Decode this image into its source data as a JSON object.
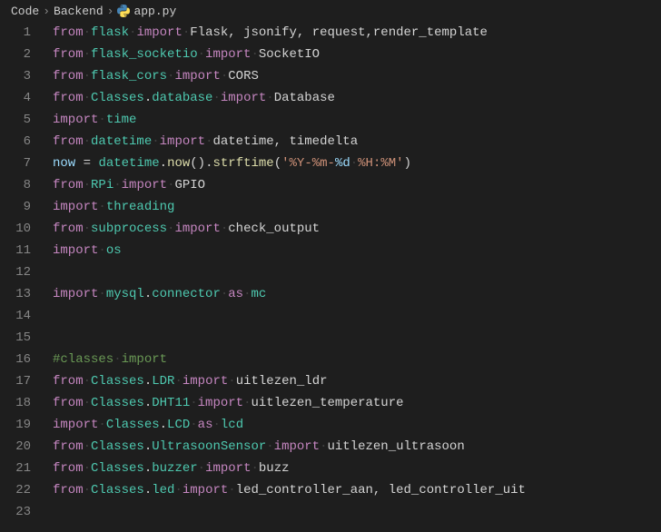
{
  "breadcrumb": {
    "items": [
      "Code",
      "Backend",
      "app.py"
    ],
    "file_icon": "python-icon"
  },
  "editor": {
    "line_count": 23,
    "lines": [
      [
        {
          "c": "tk-kw",
          "t": "from"
        },
        {
          "c": "tk-ws",
          "t": "·"
        },
        {
          "c": "tk-mod",
          "t": "flask"
        },
        {
          "c": "tk-ws",
          "t": "·"
        },
        {
          "c": "tk-kw",
          "t": "import"
        },
        {
          "c": "tk-ws",
          "t": "·"
        },
        {
          "c": "tk-id",
          "t": "Flask, jsonify, request,render_template"
        }
      ],
      [
        {
          "c": "tk-kw",
          "t": "from"
        },
        {
          "c": "tk-ws",
          "t": "·"
        },
        {
          "c": "tk-mod",
          "t": "flask_socketio"
        },
        {
          "c": "tk-ws",
          "t": "·"
        },
        {
          "c": "tk-kw",
          "t": "import"
        },
        {
          "c": "tk-ws",
          "t": "·"
        },
        {
          "c": "tk-id",
          "t": "SocketIO"
        }
      ],
      [
        {
          "c": "tk-kw",
          "t": "from"
        },
        {
          "c": "tk-ws",
          "t": "·"
        },
        {
          "c": "tk-mod",
          "t": "flask_cors"
        },
        {
          "c": "tk-ws",
          "t": "·"
        },
        {
          "c": "tk-kw",
          "t": "import"
        },
        {
          "c": "tk-ws",
          "t": "·"
        },
        {
          "c": "tk-id",
          "t": "CORS"
        }
      ],
      [
        {
          "c": "tk-kw",
          "t": "from"
        },
        {
          "c": "tk-ws",
          "t": "·"
        },
        {
          "c": "tk-mod",
          "t": "Classes"
        },
        {
          "c": "tk-punc",
          "t": "."
        },
        {
          "c": "tk-mod",
          "t": "database"
        },
        {
          "c": "tk-ws",
          "t": "·"
        },
        {
          "c": "tk-kw",
          "t": "import"
        },
        {
          "c": "tk-ws",
          "t": "·"
        },
        {
          "c": "tk-id",
          "t": "Database"
        }
      ],
      [
        {
          "c": "tk-kw",
          "t": "import"
        },
        {
          "c": "tk-ws",
          "t": "·"
        },
        {
          "c": "tk-mod",
          "t": "time"
        }
      ],
      [
        {
          "c": "tk-kw",
          "t": "from"
        },
        {
          "c": "tk-ws",
          "t": "·"
        },
        {
          "c": "tk-mod",
          "t": "datetime"
        },
        {
          "c": "tk-ws",
          "t": "·"
        },
        {
          "c": "tk-kw",
          "t": "import"
        },
        {
          "c": "tk-ws",
          "t": "·"
        },
        {
          "c": "tk-id",
          "t": "datetime, timedelta"
        }
      ],
      [
        {
          "c": "tk-var",
          "t": "now"
        },
        {
          "c": "tk-id",
          "t": " = "
        },
        {
          "c": "tk-mod",
          "t": "datetime"
        },
        {
          "c": "tk-punc",
          "t": "."
        },
        {
          "c": "tk-fn",
          "t": "now"
        },
        {
          "c": "tk-punc",
          "t": "()."
        },
        {
          "c": "tk-fn",
          "t": "strftime"
        },
        {
          "c": "tk-punc",
          "t": "("
        },
        {
          "c": "tk-str",
          "t": "'%Y-%m-"
        },
        {
          "c": "tk-var",
          "t": "%d"
        },
        {
          "c": "tk-ws",
          "t": "·"
        },
        {
          "c": "tk-str",
          "t": "%H:%M'"
        },
        {
          "c": "tk-punc",
          "t": ")"
        }
      ],
      [
        {
          "c": "tk-kw",
          "t": "from"
        },
        {
          "c": "tk-ws",
          "t": "·"
        },
        {
          "c": "tk-mod",
          "t": "RPi"
        },
        {
          "c": "tk-ws",
          "t": "·"
        },
        {
          "c": "tk-kw",
          "t": "import"
        },
        {
          "c": "tk-ws",
          "t": "·"
        },
        {
          "c": "tk-id",
          "t": "GPIO"
        }
      ],
      [
        {
          "c": "tk-kw",
          "t": "import"
        },
        {
          "c": "tk-ws",
          "t": "·"
        },
        {
          "c": "tk-mod",
          "t": "threading"
        }
      ],
      [
        {
          "c": "tk-kw",
          "t": "from"
        },
        {
          "c": "tk-ws",
          "t": "·"
        },
        {
          "c": "tk-mod",
          "t": "subprocess"
        },
        {
          "c": "tk-ws",
          "t": "·"
        },
        {
          "c": "tk-kw",
          "t": "import"
        },
        {
          "c": "tk-ws",
          "t": "·"
        },
        {
          "c": "tk-id",
          "t": "check_output"
        }
      ],
      [
        {
          "c": "tk-kw",
          "t": "import"
        },
        {
          "c": "tk-ws",
          "t": "·"
        },
        {
          "c": "tk-mod",
          "t": "os"
        }
      ],
      [],
      [
        {
          "c": "tk-kw",
          "t": "import"
        },
        {
          "c": "tk-ws",
          "t": "·"
        },
        {
          "c": "tk-mod",
          "t": "mysql"
        },
        {
          "c": "tk-punc",
          "t": "."
        },
        {
          "c": "tk-mod",
          "t": "connector"
        },
        {
          "c": "tk-ws",
          "t": "·"
        },
        {
          "c": "tk-kw",
          "t": "as"
        },
        {
          "c": "tk-ws",
          "t": "·"
        },
        {
          "c": "tk-mod",
          "t": "mc"
        }
      ],
      [],
      [],
      [
        {
          "c": "tk-cmt",
          "t": "#classes"
        },
        {
          "c": "tk-ws",
          "t": "·"
        },
        {
          "c": "tk-cmt",
          "t": "import"
        }
      ],
      [
        {
          "c": "tk-kw",
          "t": "from"
        },
        {
          "c": "tk-ws",
          "t": "·"
        },
        {
          "c": "tk-mod",
          "t": "Classes"
        },
        {
          "c": "tk-punc",
          "t": "."
        },
        {
          "c": "tk-mod",
          "t": "LDR"
        },
        {
          "c": "tk-ws",
          "t": "·"
        },
        {
          "c": "tk-kw",
          "t": "import"
        },
        {
          "c": "tk-ws",
          "t": "·"
        },
        {
          "c": "tk-id",
          "t": "uitlezen_ldr"
        }
      ],
      [
        {
          "c": "tk-kw",
          "t": "from"
        },
        {
          "c": "tk-ws",
          "t": "·"
        },
        {
          "c": "tk-mod",
          "t": "Classes"
        },
        {
          "c": "tk-punc",
          "t": "."
        },
        {
          "c": "tk-mod",
          "t": "DHT11"
        },
        {
          "c": "tk-ws",
          "t": "·"
        },
        {
          "c": "tk-kw",
          "t": "import"
        },
        {
          "c": "tk-ws",
          "t": "·"
        },
        {
          "c": "tk-id",
          "t": "uitlezen_temperature"
        }
      ],
      [
        {
          "c": "tk-kw",
          "t": "import"
        },
        {
          "c": "tk-ws",
          "t": "·"
        },
        {
          "c": "tk-mod",
          "t": "Classes"
        },
        {
          "c": "tk-punc",
          "t": "."
        },
        {
          "c": "tk-mod",
          "t": "LCD"
        },
        {
          "c": "tk-ws",
          "t": "·"
        },
        {
          "c": "tk-kw",
          "t": "as"
        },
        {
          "c": "tk-ws",
          "t": "·"
        },
        {
          "c": "tk-mod",
          "t": "lcd"
        }
      ],
      [
        {
          "c": "tk-kw",
          "t": "from"
        },
        {
          "c": "tk-ws",
          "t": "·"
        },
        {
          "c": "tk-mod",
          "t": "Classes"
        },
        {
          "c": "tk-punc",
          "t": "."
        },
        {
          "c": "tk-mod",
          "t": "UltrasoonSensor"
        },
        {
          "c": "tk-ws",
          "t": "·"
        },
        {
          "c": "tk-kw",
          "t": "import"
        },
        {
          "c": "tk-ws",
          "t": "·"
        },
        {
          "c": "tk-id",
          "t": "uitlezen_ultrasoon"
        }
      ],
      [
        {
          "c": "tk-kw",
          "t": "from"
        },
        {
          "c": "tk-ws",
          "t": "·"
        },
        {
          "c": "tk-mod",
          "t": "Classes"
        },
        {
          "c": "tk-punc",
          "t": "."
        },
        {
          "c": "tk-mod",
          "t": "buzzer"
        },
        {
          "c": "tk-ws",
          "t": "·"
        },
        {
          "c": "tk-kw",
          "t": "import"
        },
        {
          "c": "tk-ws",
          "t": "·"
        },
        {
          "c": "tk-id",
          "t": "buzz"
        }
      ],
      [
        {
          "c": "tk-kw",
          "t": "from"
        },
        {
          "c": "tk-ws",
          "t": "·"
        },
        {
          "c": "tk-mod",
          "t": "Classes"
        },
        {
          "c": "tk-punc",
          "t": "."
        },
        {
          "c": "tk-mod",
          "t": "led"
        },
        {
          "c": "tk-ws",
          "t": "·"
        },
        {
          "c": "tk-kw",
          "t": "import"
        },
        {
          "c": "tk-ws",
          "t": "·"
        },
        {
          "c": "tk-id",
          "t": "led_controller_aan, led_controller_uit"
        }
      ],
      []
    ]
  }
}
